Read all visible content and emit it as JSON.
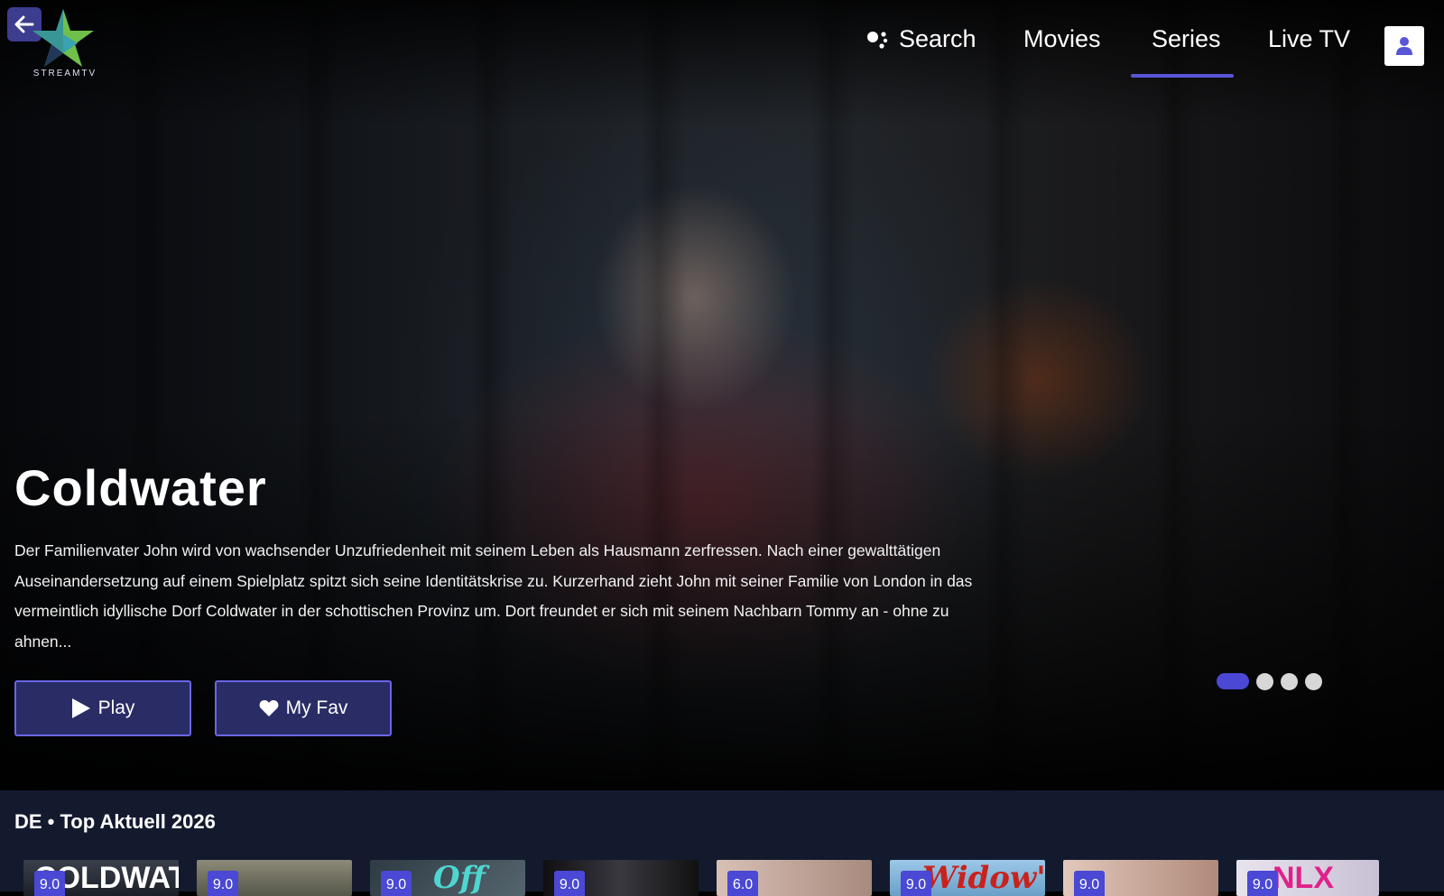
{
  "app": {
    "logo_text": "STREAMTV"
  },
  "nav": {
    "search": "Search",
    "movies": "Movies",
    "series": "Series",
    "livetv": "Live TV",
    "active": "Series"
  },
  "hero": {
    "title": "Coldwater",
    "description": "Der Familienvater John wird von wachsender Unzufriedenheit mit seinem Leben als Hausmann zerfressen. Nach einer gewalttätigen Auseinandersetzung auf einem Spielplatz spitzt sich seine Identitätskrise zu. Kurzerhand zieht John mit seiner Familie von London in das vermeintlich idyllische Dorf Coldwater in der schottischen Provinz um. Dort freundet er sich mit seinem Nachbarn Tommy an - ohne zu ahnen...",
    "play_label": "Play",
    "fav_label": "My Fav",
    "carousel_count": 4,
    "carousel_active_index": 0
  },
  "row": {
    "title": "DE • Top Aktuell 2026",
    "items": [
      {
        "rating": "9.0",
        "art_text": "COLDWATER",
        "color": "#2a2f3a"
      },
      {
        "rating": "9.0",
        "art_text": "",
        "color": "#6b6a5c"
      },
      {
        "rating": "9.0",
        "art_text": "Off",
        "color": "#3a4a52"
      },
      {
        "rating": "9.0",
        "art_text": "",
        "color": "#1f1f24"
      },
      {
        "rating": "6.0",
        "art_text": "",
        "color": "#c9a99b"
      },
      {
        "rating": "9.0",
        "art_text": "Widow's",
        "color": "#8ab6d8"
      },
      {
        "rating": "9.0",
        "art_text": "",
        "color": "#c7a89a"
      },
      {
        "rating": "9.0",
        "art_text": "NLX",
        "color": "#d9d4e0"
      }
    ]
  },
  "colors": {
    "accent": "#5856d6",
    "button_bg": "#2a2c66",
    "section_bg": "#141a2e",
    "rating_bg": "#4a48d4"
  }
}
